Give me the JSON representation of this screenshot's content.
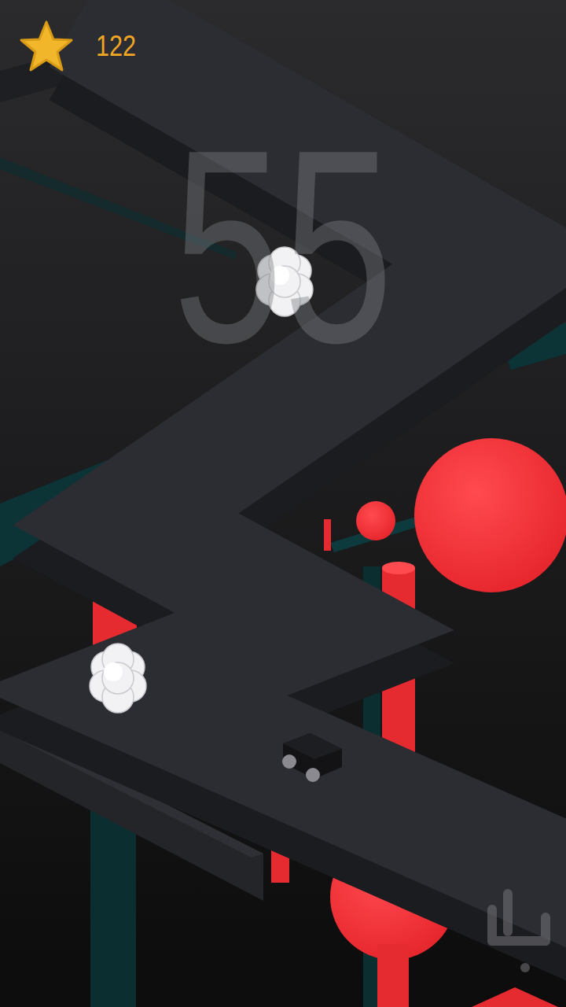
{
  "hud": {
    "stars": "122"
  },
  "score": "55"
}
